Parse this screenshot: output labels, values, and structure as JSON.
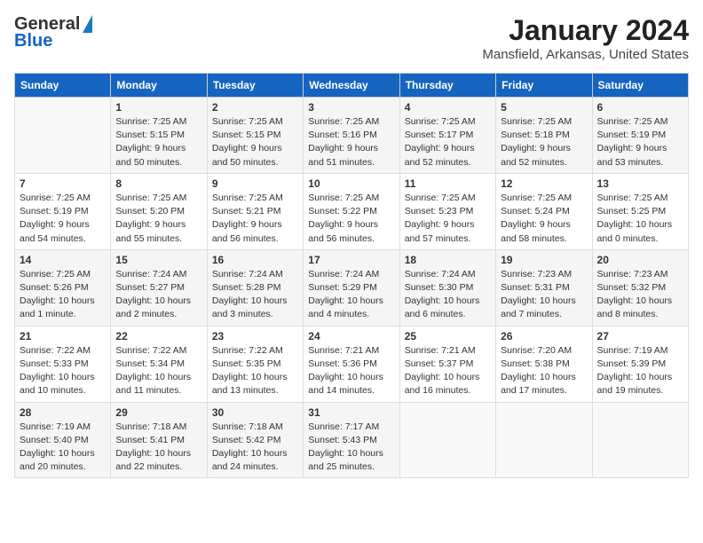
{
  "logo": {
    "general": "General",
    "blue": "Blue"
  },
  "title": "January 2024",
  "subtitle": "Mansfield, Arkansas, United States",
  "days_of_week": [
    "Sunday",
    "Monday",
    "Tuesday",
    "Wednesday",
    "Thursday",
    "Friday",
    "Saturday"
  ],
  "weeks": [
    [
      {
        "day": "",
        "sunrise": "",
        "sunset": "",
        "daylight": ""
      },
      {
        "day": "1",
        "sunrise": "Sunrise: 7:25 AM",
        "sunset": "Sunset: 5:15 PM",
        "daylight": "Daylight: 9 hours and 50 minutes."
      },
      {
        "day": "2",
        "sunrise": "Sunrise: 7:25 AM",
        "sunset": "Sunset: 5:15 PM",
        "daylight": "Daylight: 9 hours and 50 minutes."
      },
      {
        "day": "3",
        "sunrise": "Sunrise: 7:25 AM",
        "sunset": "Sunset: 5:16 PM",
        "daylight": "Daylight: 9 hours and 51 minutes."
      },
      {
        "day": "4",
        "sunrise": "Sunrise: 7:25 AM",
        "sunset": "Sunset: 5:17 PM",
        "daylight": "Daylight: 9 hours and 52 minutes."
      },
      {
        "day": "5",
        "sunrise": "Sunrise: 7:25 AM",
        "sunset": "Sunset: 5:18 PM",
        "daylight": "Daylight: 9 hours and 52 minutes."
      },
      {
        "day": "6",
        "sunrise": "Sunrise: 7:25 AM",
        "sunset": "Sunset: 5:19 PM",
        "daylight": "Daylight: 9 hours and 53 minutes."
      }
    ],
    [
      {
        "day": "7",
        "sunrise": "Sunrise: 7:25 AM",
        "sunset": "Sunset: 5:19 PM",
        "daylight": "Daylight: 9 hours and 54 minutes."
      },
      {
        "day": "8",
        "sunrise": "Sunrise: 7:25 AM",
        "sunset": "Sunset: 5:20 PM",
        "daylight": "Daylight: 9 hours and 55 minutes."
      },
      {
        "day": "9",
        "sunrise": "Sunrise: 7:25 AM",
        "sunset": "Sunset: 5:21 PM",
        "daylight": "Daylight: 9 hours and 56 minutes."
      },
      {
        "day": "10",
        "sunrise": "Sunrise: 7:25 AM",
        "sunset": "Sunset: 5:22 PM",
        "daylight": "Daylight: 9 hours and 56 minutes."
      },
      {
        "day": "11",
        "sunrise": "Sunrise: 7:25 AM",
        "sunset": "Sunset: 5:23 PM",
        "daylight": "Daylight: 9 hours and 57 minutes."
      },
      {
        "day": "12",
        "sunrise": "Sunrise: 7:25 AM",
        "sunset": "Sunset: 5:24 PM",
        "daylight": "Daylight: 9 hours and 58 minutes."
      },
      {
        "day": "13",
        "sunrise": "Sunrise: 7:25 AM",
        "sunset": "Sunset: 5:25 PM",
        "daylight": "Daylight: 10 hours and 0 minutes."
      }
    ],
    [
      {
        "day": "14",
        "sunrise": "Sunrise: 7:25 AM",
        "sunset": "Sunset: 5:26 PM",
        "daylight": "Daylight: 10 hours and 1 minute."
      },
      {
        "day": "15",
        "sunrise": "Sunrise: 7:24 AM",
        "sunset": "Sunset: 5:27 PM",
        "daylight": "Daylight: 10 hours and 2 minutes."
      },
      {
        "day": "16",
        "sunrise": "Sunrise: 7:24 AM",
        "sunset": "Sunset: 5:28 PM",
        "daylight": "Daylight: 10 hours and 3 minutes."
      },
      {
        "day": "17",
        "sunrise": "Sunrise: 7:24 AM",
        "sunset": "Sunset: 5:29 PM",
        "daylight": "Daylight: 10 hours and 4 minutes."
      },
      {
        "day": "18",
        "sunrise": "Sunrise: 7:24 AM",
        "sunset": "Sunset: 5:30 PM",
        "daylight": "Daylight: 10 hours and 6 minutes."
      },
      {
        "day": "19",
        "sunrise": "Sunrise: 7:23 AM",
        "sunset": "Sunset: 5:31 PM",
        "daylight": "Daylight: 10 hours and 7 minutes."
      },
      {
        "day": "20",
        "sunrise": "Sunrise: 7:23 AM",
        "sunset": "Sunset: 5:32 PM",
        "daylight": "Daylight: 10 hours and 8 minutes."
      }
    ],
    [
      {
        "day": "21",
        "sunrise": "Sunrise: 7:22 AM",
        "sunset": "Sunset: 5:33 PM",
        "daylight": "Daylight: 10 hours and 10 minutes."
      },
      {
        "day": "22",
        "sunrise": "Sunrise: 7:22 AM",
        "sunset": "Sunset: 5:34 PM",
        "daylight": "Daylight: 10 hours and 11 minutes."
      },
      {
        "day": "23",
        "sunrise": "Sunrise: 7:22 AM",
        "sunset": "Sunset: 5:35 PM",
        "daylight": "Daylight: 10 hours and 13 minutes."
      },
      {
        "day": "24",
        "sunrise": "Sunrise: 7:21 AM",
        "sunset": "Sunset: 5:36 PM",
        "daylight": "Daylight: 10 hours and 14 minutes."
      },
      {
        "day": "25",
        "sunrise": "Sunrise: 7:21 AM",
        "sunset": "Sunset: 5:37 PM",
        "daylight": "Daylight: 10 hours and 16 minutes."
      },
      {
        "day": "26",
        "sunrise": "Sunrise: 7:20 AM",
        "sunset": "Sunset: 5:38 PM",
        "daylight": "Daylight: 10 hours and 17 minutes."
      },
      {
        "day": "27",
        "sunrise": "Sunrise: 7:19 AM",
        "sunset": "Sunset: 5:39 PM",
        "daylight": "Daylight: 10 hours and 19 minutes."
      }
    ],
    [
      {
        "day": "28",
        "sunrise": "Sunrise: 7:19 AM",
        "sunset": "Sunset: 5:40 PM",
        "daylight": "Daylight: 10 hours and 20 minutes."
      },
      {
        "day": "29",
        "sunrise": "Sunrise: 7:18 AM",
        "sunset": "Sunset: 5:41 PM",
        "daylight": "Daylight: 10 hours and 22 minutes."
      },
      {
        "day": "30",
        "sunrise": "Sunrise: 7:18 AM",
        "sunset": "Sunset: 5:42 PM",
        "daylight": "Daylight: 10 hours and 24 minutes."
      },
      {
        "day": "31",
        "sunrise": "Sunrise: 7:17 AM",
        "sunset": "Sunset: 5:43 PM",
        "daylight": "Daylight: 10 hours and 25 minutes."
      },
      {
        "day": "",
        "sunrise": "",
        "sunset": "",
        "daylight": ""
      },
      {
        "day": "",
        "sunrise": "",
        "sunset": "",
        "daylight": ""
      },
      {
        "day": "",
        "sunrise": "",
        "sunset": "",
        "daylight": ""
      }
    ]
  ]
}
